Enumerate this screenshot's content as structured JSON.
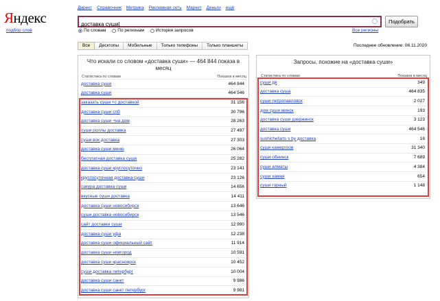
{
  "logo": {
    "text_first": "Я",
    "text_rest": "ндекс",
    "sub": "подбор слов"
  },
  "top_nav": [
    "Директ",
    "Справочник",
    "Метрика",
    "Рекламная сеть",
    "Маркет",
    "Деньги",
    "ещё"
  ],
  "search": {
    "value": "доставка суши|",
    "button": "Подобрать"
  },
  "modes": [
    {
      "label": "По словам",
      "selected": true
    },
    {
      "label": "По регионам",
      "selected": false
    },
    {
      "label": "История запросов",
      "selected": false
    }
  ],
  "regions_link": "Все регионы",
  "tabs": [
    "Все",
    "Десктопы",
    "Мобильные",
    "Только телефоны",
    "Только планшеты"
  ],
  "updated": "Последнее обновление: 06.11.2020",
  "left": {
    "title": "Что искали со словом «доставка суши» — 464 844 показа в месяц",
    "col_query": "Статистика по словам",
    "col_count": "Показов в месяц",
    "rows": [
      {
        "q": "доставка суши",
        "n": "464 844"
      },
      {
        "q": "доставка суши",
        "n": "464 546"
      },
      {
        "q": "заказать суши +с доставкой",
        "n": "31 156"
      },
      {
        "q": "доставка суши спб",
        "n": "30 796"
      },
      {
        "q": "доставка суши +на дом",
        "n": "28 263"
      },
      {
        "q": "суши роллы доставка",
        "n": "27 497"
      },
      {
        "q": "суши вок доставка",
        "n": "27 303"
      },
      {
        "q": "доставка суши меню",
        "n": "26 064"
      },
      {
        "q": "бесплатная доставка суши",
        "n": "25 282"
      },
      {
        "q": "доставка суши круглосуточно",
        "n": "23 141"
      },
      {
        "q": "круглосуточная доставка суши",
        "n": "23 126"
      },
      {
        "q": "сакура доставка суши",
        "n": "14 656"
      },
      {
        "q": "вкусные суши доставка",
        "n": "14 411"
      },
      {
        "q": "доставка суши новосибирск",
        "n": "13 646"
      },
      {
        "q": "суши доставка новосибирск",
        "n": "13 546"
      },
      {
        "q": "сайт доставки суши",
        "n": "12 990"
      },
      {
        "q": "доставка суши уфа",
        "n": "12 238"
      },
      {
        "q": "доставка суши официальный сайт",
        "n": "11 914"
      },
      {
        "q": "доставка суши новгород",
        "n": "10 591"
      },
      {
        "q": "доставка суши красноярск",
        "n": "10 452"
      },
      {
        "q": "суши доставка петербург",
        "n": "10 004"
      },
      {
        "q": "доставка суши санкт",
        "n": "9 986"
      },
      {
        "q": "доставка суши санкт петербург",
        "n": "9 981"
      }
    ]
  },
  "right": {
    "title": "Запросы, похожие на «доставка суши»",
    "col_query": "Статистика по словам",
    "col_count": "Показов в месяц",
    "rows": [
      {
        "q": "суши дв",
        "n": "349"
      },
      {
        "q": "доставка суша",
        "n": "464 835"
      },
      {
        "q": "суши петропавловск",
        "n": "2 027"
      },
      {
        "q": "дом суши минск",
        "n": "193"
      },
      {
        "q": "доставка суши дзержинск",
        "n": "3 123"
      },
      {
        "q": "доставка суши",
        "n": "464 546"
      },
      {
        "q": "sushichefarts s by доставка",
        "n": "16"
      },
      {
        "q": "суши камергоов",
        "n": "31 340"
      },
      {
        "q": "суши обнинск",
        "n": "7 689"
      },
      {
        "q": "суши алматы",
        "n": "4 384"
      },
      {
        "q": "суши хамая",
        "n": "654"
      },
      {
        "q": "суши горный",
        "n": "1 148"
      }
    ]
  },
  "colors": {
    "link": "#1a3dc1",
    "search_border": "#8a2e49",
    "highlight": "#e03a3a",
    "logo_red": "#e00000"
  }
}
